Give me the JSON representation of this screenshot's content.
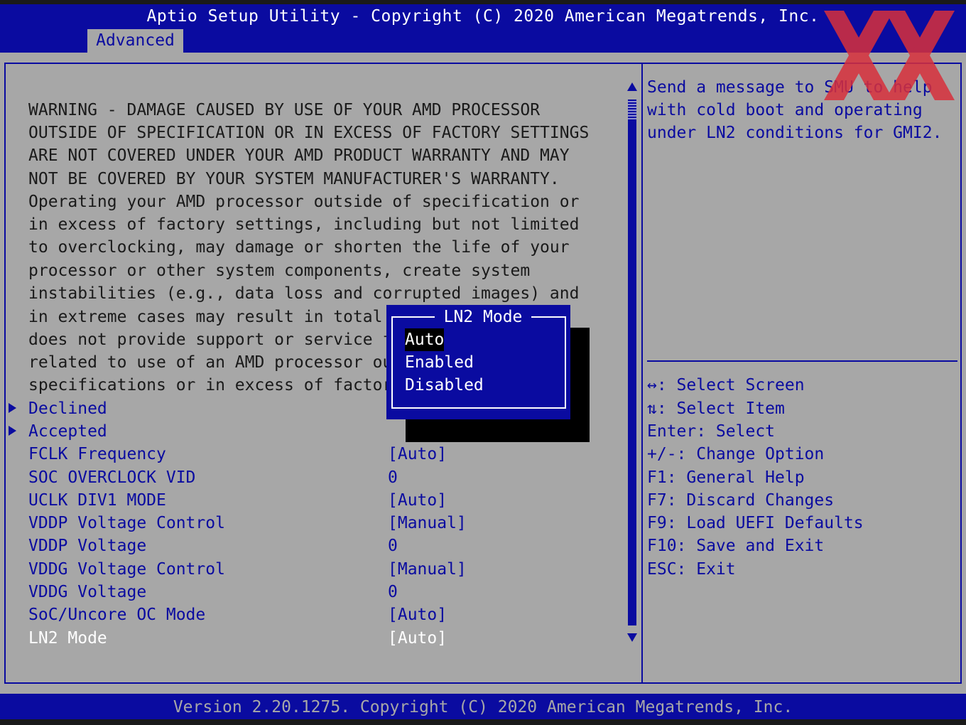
{
  "header": {
    "title": "Aptio Setup Utility - Copyright (C) 2020 American Megatrends, Inc.",
    "tab": "Advanced"
  },
  "warning": [
    "WARNING - DAMAGE CAUSED BY USE OF YOUR AMD PROCESSOR",
    "OUTSIDE OF SPECIFICATION OR IN EXCESS OF FACTORY SETTINGS",
    "ARE NOT COVERED UNDER YOUR AMD PRODUCT WARRANTY AND MAY",
    "NOT BE COVERED BY YOUR SYSTEM MANUFACTURER'S WARRANTY.",
    "Operating your AMD processor outside of specification or",
    "in excess of factory settings, including but not limited",
    "to overclocking, may damage or shorten the life of your",
    "processor or other system components, create system",
    "instabilities (e.g., data loss and corrupted images) and",
    "in extreme cases may result in total",
    "does not provide support or service f",
    "related to use of an AMD processor ou",
    "specifications or in excess of factor"
  ],
  "submenus": [
    "Declined",
    "Accepted"
  ],
  "settings": [
    {
      "label": "FCLK Frequency",
      "value": "[Auto]"
    },
    {
      "label": "SOC OVERCLOCK VID",
      "value": "0"
    },
    {
      "label": "UCLK DIV1 MODE",
      "value": "[Auto]"
    },
    {
      "label": "VDDP Voltage Control",
      "value": "[Manual]"
    },
    {
      "label": "VDDP Voltage",
      "value": "0"
    },
    {
      "label": "VDDG Voltage Control",
      "value": "[Manual]"
    },
    {
      "label": "VDDG Voltage",
      "value": "0"
    },
    {
      "label": "SoC/Uncore OC Mode",
      "value": "[Auto]"
    },
    {
      "label": "LN2 Mode",
      "value": "[Auto]"
    }
  ],
  "help": [
    "Send a message to SMU to help",
    "with cold boot and operating",
    "under LN2 conditions for GMI2."
  ],
  "keys": [
    "↔: Select Screen",
    "⇅: Select Item",
    "Enter: Select",
    "+/-: Change Option",
    "F1: General Help",
    "F7: Discard Changes",
    "F9: Load UEFI Defaults",
    "F10: Save and Exit",
    "ESC: Exit"
  ],
  "popup": {
    "title": "LN2 Mode",
    "options": [
      "Auto",
      "Enabled",
      "Disabled"
    ],
    "selected": "Auto"
  },
  "footer": {
    "version": "Version 2.20.1275. Copyright (C) 2020 American Megatrends, Inc."
  },
  "colors": {
    "primary_blue": "#0a0ba0",
    "panel_gray": "#a7a7a7",
    "watermark_red": "#d8303c"
  }
}
